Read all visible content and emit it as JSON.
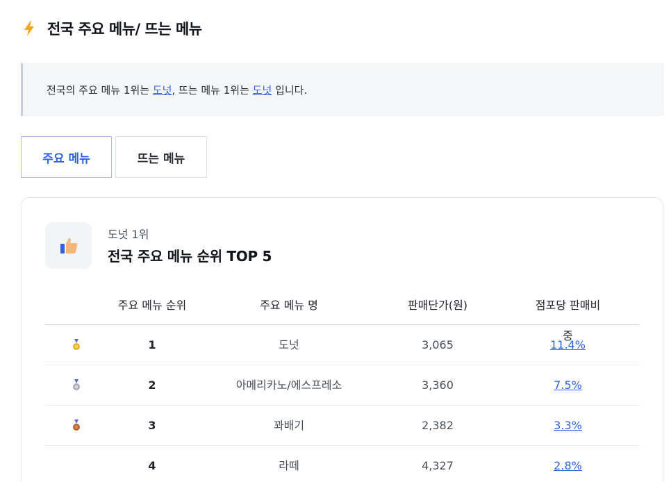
{
  "header": {
    "title": "전국 주요 메뉴/ 뜨는 메뉴",
    "icon": "lightning-icon",
    "icon_color": "#f5a623"
  },
  "notice": {
    "prefix": "전국의 주요 메뉴 1위는",
    "main_top": "도넛",
    "middle": ", 뜨는 메뉴 1위는",
    "hot_top": "도넛",
    "suffix": "입니다."
  },
  "tabs": [
    {
      "label": "주요 메뉴",
      "active": true
    },
    {
      "label": "뜨는 메뉴",
      "active": false
    }
  ],
  "card": {
    "icon": "thumbs-up-icon",
    "subtitle": "도넛 1위",
    "title": "전국 주요 메뉴 순위 TOP 5"
  },
  "table": {
    "headers": [
      "주요 메뉴 순위",
      "주요 메뉴 명",
      "판매단가(원)",
      "점포당 판매비중"
    ],
    "rows": [
      {
        "medal": "gold-medal-icon",
        "rank": "1",
        "name": "도넛",
        "price": "3,065",
        "share": "11.4%"
      },
      {
        "medal": "silver-medal-icon",
        "rank": "2",
        "name": "아메리카노/에스프레소",
        "price": "3,360",
        "share": "7.5%"
      },
      {
        "medal": "bronze-medal-icon",
        "rank": "3",
        "name": "꽈배기",
        "price": "2,382",
        "share": "3.3%"
      },
      {
        "medal": "",
        "rank": "4",
        "name": "라떼",
        "price": "4,327",
        "share": "2.8%"
      }
    ]
  },
  "colors": {
    "accent": "#2f62e0",
    "gold": "#e8b425",
    "silver": "#a9adb4",
    "bronze": "#b5652c"
  }
}
